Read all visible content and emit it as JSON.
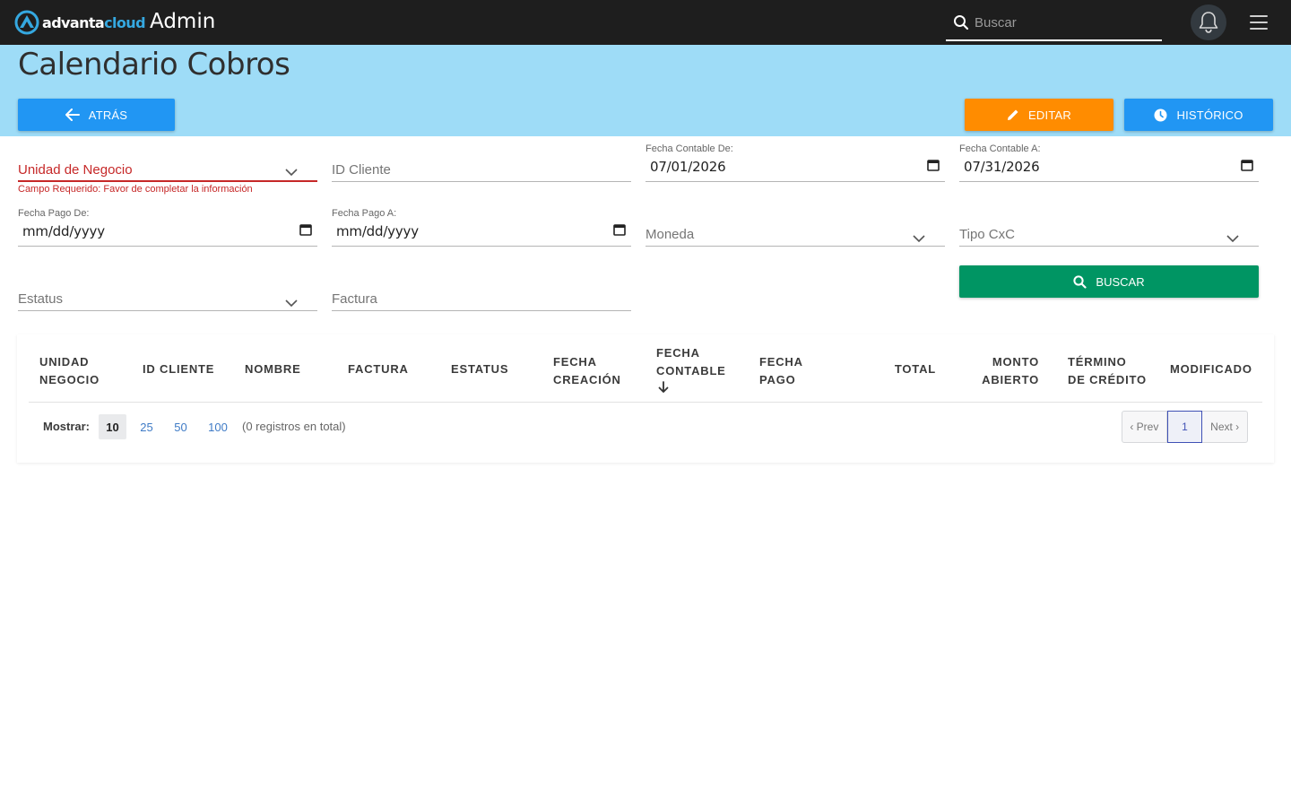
{
  "topbar": {
    "logo_primary": "advanta",
    "logo_secondary": "cloud",
    "app_title": "Admin",
    "search_placeholder": "Buscar"
  },
  "header": {
    "title": "Calendario Cobros",
    "back_label": "ATRÁS",
    "edit_label": "EDITAR",
    "history_label": "HISTÓRICO"
  },
  "filters": {
    "unidad_negocio": "Unidad de Negocio",
    "unidad_error": "Campo Requerido: Favor de completar la información",
    "id_cliente": "ID Cliente",
    "fecha_contable_de_label": "Fecha Contable De:",
    "fecha_contable_de_value": "07/01/2026",
    "fecha_contable_a_label": "Fecha Contable A:",
    "fecha_contable_a_value": "07/31/2026",
    "fecha_pago_de_label": "Fecha Pago De:",
    "fecha_pago_de_value": "mm/dd/yyyy",
    "fecha_pago_a_label": "Fecha Pago A:",
    "fecha_pago_a_value": "mm/dd/yyyy",
    "moneda": "Moneda",
    "tipo_cxc": "Tipo CxC",
    "estatus": "Estatus",
    "factura": "Factura",
    "buscar_label": "BUSCAR"
  },
  "table": {
    "columns": [
      {
        "l1": "UNIDAD",
        "l2": "NEGOCIO"
      },
      {
        "l1": "ID CLIENTE",
        "l2": ""
      },
      {
        "l1": "NOMBRE",
        "l2": ""
      },
      {
        "l1": "FACTURA",
        "l2": ""
      },
      {
        "l1": "ESTATUS",
        "l2": ""
      },
      {
        "l1": "FECHA",
        "l2": "CREACIÓN"
      },
      {
        "l1": "FECHA",
        "l2": "CONTABLE"
      },
      {
        "l1": "FECHA",
        "l2": "PAGO"
      },
      {
        "l1": "TOTAL",
        "l2": ""
      },
      {
        "l1": "MONTO",
        "l2": "ABIERTO"
      },
      {
        "l1": "TÉRMINO",
        "l2": "DE CRÉDITO"
      },
      {
        "l1": "MODIFICADO",
        "l2": ""
      }
    ],
    "sort_column": "FECHA CONTABLE",
    "sort_direction": "desc"
  },
  "pagination": {
    "show_label": "Mostrar:",
    "sizes": [
      "10",
      "25",
      "50",
      "100"
    ],
    "selected_size": "10",
    "total_text": "(0 registros en total)",
    "prev": "‹ Prev",
    "current": "1",
    "next": "Next ›"
  },
  "colors": {
    "topbar": "#1e1e1e",
    "header_band": "#9edcf7",
    "primary": "#2196f3",
    "edit": "#ff8c00",
    "search": "#009563",
    "error": "#c62828"
  }
}
